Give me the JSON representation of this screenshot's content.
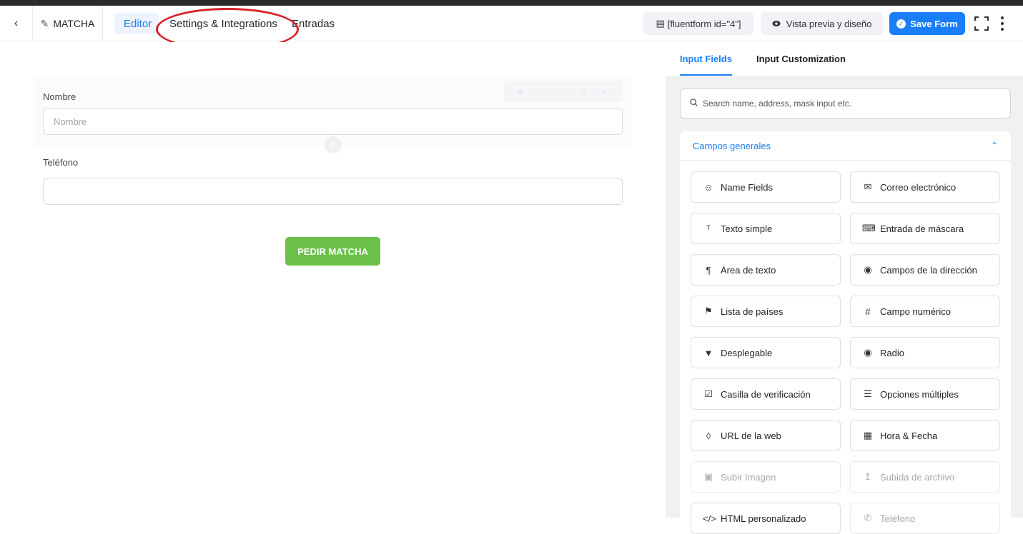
{
  "header": {
    "back_icon": "chevron-left-icon",
    "form_title": "MATCHA",
    "tabs": [
      {
        "label": "Editor",
        "active": true
      },
      {
        "label": "Settings & Integrations",
        "active": false
      },
      {
        "label": "Entradas",
        "active": false
      }
    ],
    "shortcode": "[fluentform id=\"4\"]",
    "preview_label": "Vista previa y diseño",
    "save_label": "Save Form",
    "accent_color": "#1a7efb",
    "annotation_color": "#d6202a"
  },
  "editor": {
    "fields": [
      {
        "label": "Nombre",
        "placeholder": "Nombre"
      },
      {
        "label": "Teléfono",
        "placeholder": ""
      }
    ],
    "submit_label": "PEDIR MATCHA",
    "submit_color": "#6bc047"
  },
  "panel": {
    "tabs": [
      {
        "label": "Input Fields",
        "active": true
      },
      {
        "label": "Input Customization",
        "active": false
      }
    ],
    "search_placeholder": "Search name, address, mask input etc.",
    "group_title": "Campos generales",
    "fields": [
      {
        "label": "Name Fields",
        "icon": "user-icon",
        "disabled": false
      },
      {
        "label": "Correo electrónico",
        "icon": "envelope-icon",
        "disabled": false
      },
      {
        "label": "Texto simple",
        "icon": "text-cursor-icon",
        "disabled": false
      },
      {
        "label": "Entrada de máscara",
        "icon": "keyboard-icon",
        "disabled": false
      },
      {
        "label": "Área de texto",
        "icon": "paragraph-icon",
        "disabled": false
      },
      {
        "label": "Campos de la dirección",
        "icon": "map-pin-icon",
        "disabled": false
      },
      {
        "label": "Lista de países",
        "icon": "flag-icon",
        "disabled": false
      },
      {
        "label": "Campo numérico",
        "icon": "hash-icon",
        "disabled": false
      },
      {
        "label": "Desplegable",
        "icon": "dropdown-icon",
        "disabled": false
      },
      {
        "label": "Radio",
        "icon": "radio-icon",
        "disabled": false
      },
      {
        "label": "Casilla de verificación",
        "icon": "checkbox-icon",
        "disabled": false
      },
      {
        "label": "Opciones múltiples",
        "icon": "list-icon",
        "disabled": false
      },
      {
        "label": "URL de la web",
        "icon": "link-icon",
        "disabled": false
      },
      {
        "label": "Hora & Fecha",
        "icon": "calendar-icon",
        "disabled": false
      },
      {
        "label": "Subir Imagen",
        "icon": "image-upload-icon",
        "disabled": true
      },
      {
        "label": "Subida de archivo",
        "icon": "file-upload-icon",
        "disabled": true
      },
      {
        "label": "HTML personalizado",
        "icon": "code-icon",
        "disabled": false
      },
      {
        "label": "Teléfono",
        "icon": "phone-icon",
        "disabled": true
      }
    ]
  }
}
